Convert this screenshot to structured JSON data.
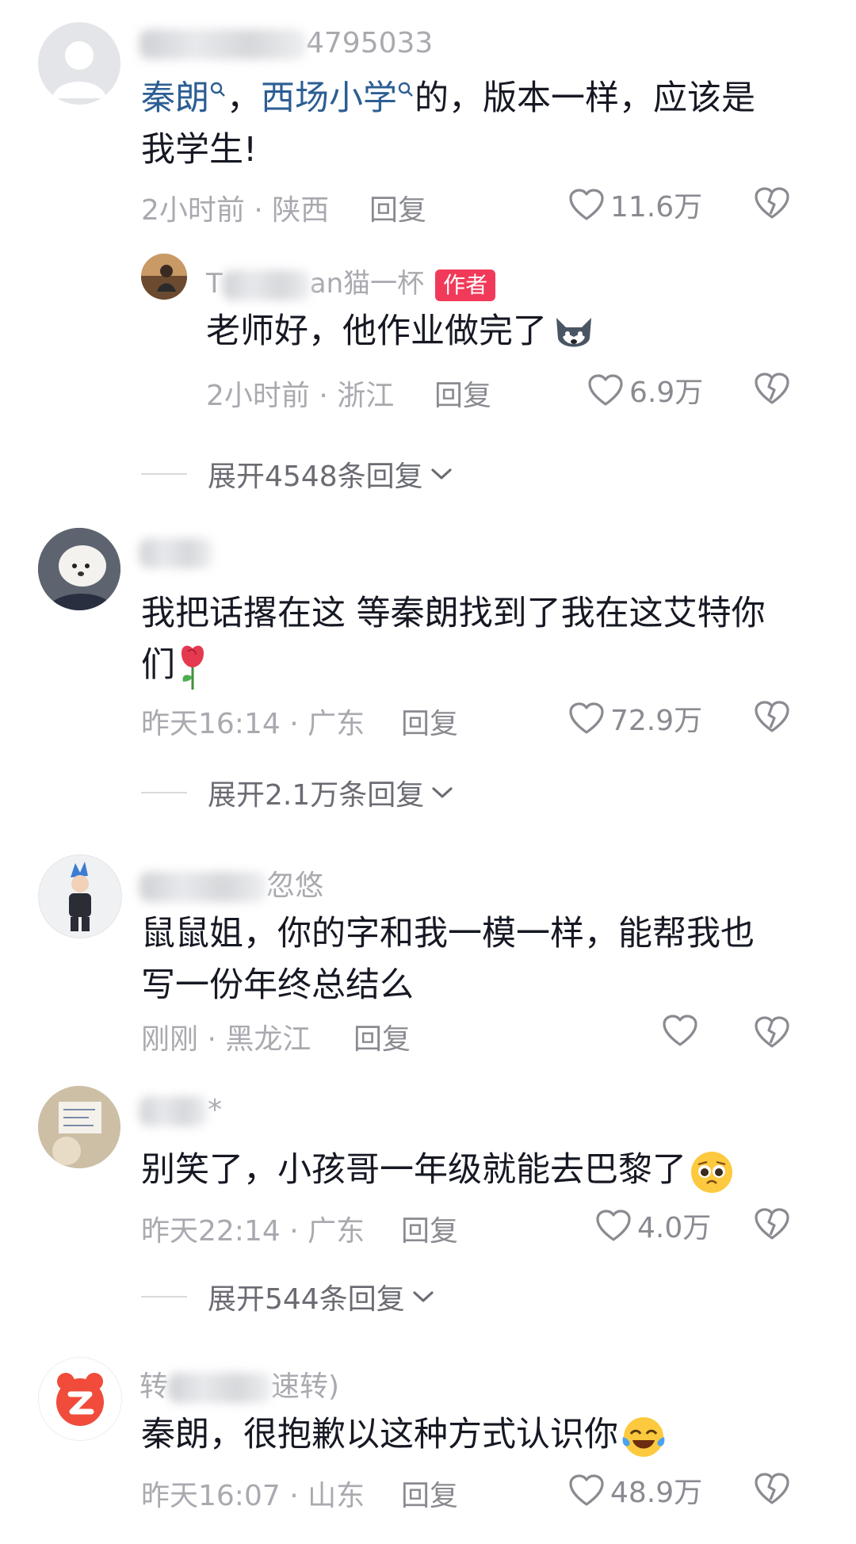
{
  "comments": [
    {
      "name_visible": "4795033",
      "text_parts": [
        "秦朗",
        "，",
        "西场小学",
        "的，版本一样，应该是",
        "我学生!"
      ],
      "time_loc": "2小时前 · 陕西",
      "reply_label": "回复",
      "likes": "11.6万",
      "author_reply": {
        "name_visible_a": "T",
        "name_visible_b": "an猫一杯",
        "badge": "作者",
        "text": "老师好，他作业做完了",
        "time_loc": "2小时前 · 浙江",
        "reply_label": "回复",
        "likes": "6.9万"
      },
      "expand": "展开4548条回复"
    },
    {
      "text_line1": "我把话撂在这 等秦朗找到了我在这艾特你",
      "text_line2": "们",
      "time_loc": "昨天16:14 · 广东",
      "reply_label": "回复",
      "likes": "72.9万",
      "expand": "展开2.1万条回复"
    },
    {
      "name_visible": "忽悠",
      "text_line1": "鼠鼠姐，你的字和我一模一样，能帮我也",
      "text_line2": "写一份年终总结么",
      "time_loc": "刚刚 · 黑龙江",
      "reply_label": "回复"
    },
    {
      "name_visible": "*",
      "text": "别笑了，小孩哥一年级就能去巴黎了",
      "time_loc": "昨天22:14 · 广东",
      "reply_label": "回复",
      "likes": "4.0万",
      "expand": "展开544条回复"
    },
    {
      "name_visible_a": "转",
      "name_visible_b": "速转)",
      "text": "秦朗，很抱歉以这种方式认识你",
      "time_loc": "昨天16:07 · 山东",
      "reply_label": "回复",
      "likes": "48.9万"
    }
  ],
  "colors": {
    "link": "#2c5e93",
    "badge": "#f13a5a",
    "meta": "#a9aab0"
  },
  "icons": [
    "search-mini-icon",
    "heart-outline-icon",
    "broken-heart-icon",
    "chevron-down-icon",
    "wolf-emoji",
    "rose-emoji",
    "pleading-face-emoji",
    "tears-of-joy-emoji",
    "xiaohongshu-logo"
  ]
}
